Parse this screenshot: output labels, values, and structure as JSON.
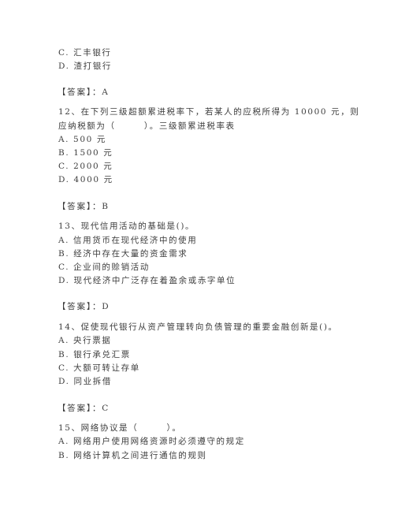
{
  "document": {
    "prev_question_tail": {
      "options": [
        "C. 汇丰银行",
        "D. 渣打银行"
      ],
      "answer_label": "【答案】：A"
    },
    "questions": [
      {
        "number": "12",
        "stem_lines": [
          "12、在下列三级超额累进税率下，若某人的应税所得为 10000 元，则",
          "应纳税额为（　　　）。三级额累进税率表"
        ],
        "options": [
          "A. 500 元",
          "B. 1500 元",
          "C. 2000 元",
          "D. 4000 元"
        ],
        "answer_label": "【答案】：B"
      },
      {
        "number": "13",
        "stem_lines": [
          "13、现代信用活动的基础是()。"
        ],
        "options": [
          "A. 信用货币在现代经济中的使用",
          "B. 经济中存在大量的资金需求",
          "C. 企业间的赊销活动",
          "D. 现代经济中广泛存在着盈余或赤字单位"
        ],
        "answer_label": "【答案】：D"
      },
      {
        "number": "14",
        "stem_lines": [
          "14、促使现代银行从资产管理转向负债管理的重要金融创新是()。"
        ],
        "options": [
          "A. 央行票据",
          "B. 银行承兑汇票",
          "C. 大额可转让存单",
          "D. 同业拆借"
        ],
        "answer_label": "【答案】：C"
      },
      {
        "number": "15",
        "stem_lines": [
          "15、网络协议是（　　　）。"
        ],
        "options": [
          "A. 网络用户使用网络资源时必须遵守的规定",
          "B. 网络计算机之间进行通信的规则"
        ]
      }
    ]
  }
}
